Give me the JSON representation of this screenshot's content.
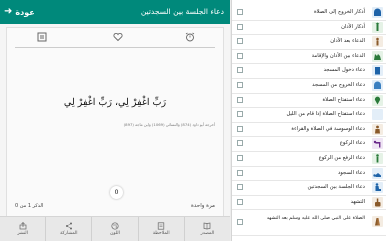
{
  "header": {
    "title": "دعاء الجلسة بين السجدتين",
    "back_label": "عودة"
  },
  "card": {
    "dua": "رَبِّ اغْفِرْ لِي، رَبِّ اغْفِرْ لِي",
    "source": "أخرجه أبو داود (874) والنسائي (1069) وابن ماجه (897)",
    "repeat_label": "مرة واحدة",
    "count_label": "الذكر 1 من 0",
    "counter_value": "0",
    "icons": [
      "alarm-icon",
      "heart-icon",
      "settings-icon"
    ]
  },
  "toolbar": [
    {
      "name": "share-button",
      "label": "النشر",
      "icon": "share-icon"
    },
    {
      "name": "sharing-button",
      "label": "المشاركة",
      "icon": "share-nodes-icon"
    },
    {
      "name": "color-button",
      "label": "اللون",
      "icon": "palette-icon"
    },
    {
      "name": "notes-button",
      "label": "الملاحظة",
      "icon": "note-icon"
    },
    {
      "name": "source-button",
      "label": "المصدر",
      "icon": "book-icon"
    }
  ],
  "sidebar": {
    "items": [
      {
        "label": "أذكار الخروج إلى الصلاة",
        "icon": "mosque-icon",
        "color": "#1e63a8"
      },
      {
        "label": "أذكار الأذان",
        "icon": "minaret-icon",
        "color": "#2a7a3a"
      },
      {
        "label": "الدعاء بعد الأذان",
        "icon": "person-raising-icon",
        "color": "#8a5a2a"
      },
      {
        "label": "الدعاء بين الأذان والإقامة",
        "icon": "hands-icon",
        "color": "#2a7a3a"
      },
      {
        "label": "دعاء دخول المسجد",
        "icon": "door-icon",
        "color": "#1e63a8"
      },
      {
        "label": "دعاء الخروج من المسجد",
        "icon": "mosque-exit-icon",
        "color": "#1e63a8"
      },
      {
        "label": "دعاء استفتاح الصلاة",
        "icon": "location-icon",
        "color": "#2a7a3a"
      },
      {
        "label": "دعاء استفتاح الصلاة إذا قام من الليل",
        "icon": "moon-icon",
        "color": "#1e63a8"
      },
      {
        "label": "دعاء الوسوسة في الصلاة والقراءة",
        "icon": "person-icon",
        "color": "#8a5a2a"
      },
      {
        "label": "دعاء الركوع",
        "icon": "bowing-icon",
        "color": "#6a2a8a"
      },
      {
        "label": "دعاء الرفع من الركوع",
        "icon": "standing-icon",
        "color": "#2a7a3a"
      },
      {
        "label": "دعاء السجود",
        "icon": "prostration-icon",
        "color": "#1e63a8"
      },
      {
        "label": "دعاء الجلسة بين السجدتين",
        "icon": "sitting-icon",
        "color": "#1e63a8"
      },
      {
        "label": "التشهد",
        "icon": "finger-icon",
        "color": "#8a5a2a"
      },
      {
        "label": "الصلاة على النبي صلى الله عليه وسلم بعد التشهد",
        "icon": "prayer-hands-icon",
        "color": "#8a5a2a"
      }
    ]
  }
}
